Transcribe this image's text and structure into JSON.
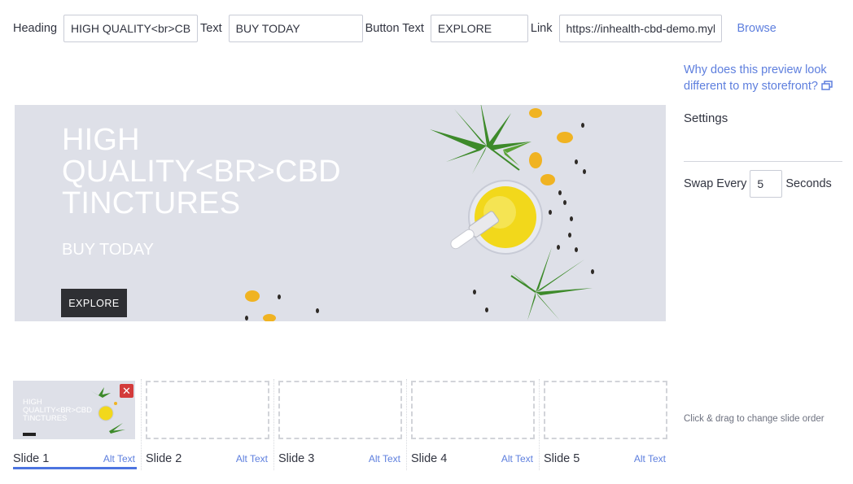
{
  "form": {
    "heading_label": "Heading",
    "heading_value": "HIGH QUALITY<br>CBD TINCTURES",
    "text_label": "Text",
    "text_value": "BUY TODAY",
    "button_text_label": "Button Text",
    "button_text_value": "EXPLORE",
    "link_label": "Link",
    "link_value": "https://inhealth-cbd-demo.mybigcommerce.com",
    "browse_label": "Browse"
  },
  "preview_help": "Why does this preview look different to my storefront?",
  "settings": {
    "title": "Settings",
    "swap_label": "Swap Every",
    "swap_value": "5",
    "seconds_label": "Seconds"
  },
  "banner": {
    "heading": "HIGH QUALITY<BR>CBD TINCTURES",
    "text": "BUY TODAY",
    "button": "EXPLORE",
    "background_color": "#dee0e8"
  },
  "slides": [
    {
      "label": "Slide 1",
      "alt": "Alt Text",
      "active": true,
      "mini_heading": "HIGH QUALITY<BR>CBD TINCTURES"
    },
    {
      "label": "Slide 2",
      "alt": "Alt Text",
      "active": false
    },
    {
      "label": "Slide 3",
      "alt": "Alt Text",
      "active": false
    },
    {
      "label": "Slide 4",
      "alt": "Alt Text",
      "active": false
    },
    {
      "label": "Slide 5",
      "alt": "Alt Text",
      "active": false
    }
  ],
  "close_glyph": "✕",
  "drag_hint": "Click & drag to change slide order",
  "colors": {
    "link": "#5e7fde",
    "active_tab": "#4c74e0",
    "delete": "#d33b3b",
    "button_dark": "#2e2f33"
  }
}
